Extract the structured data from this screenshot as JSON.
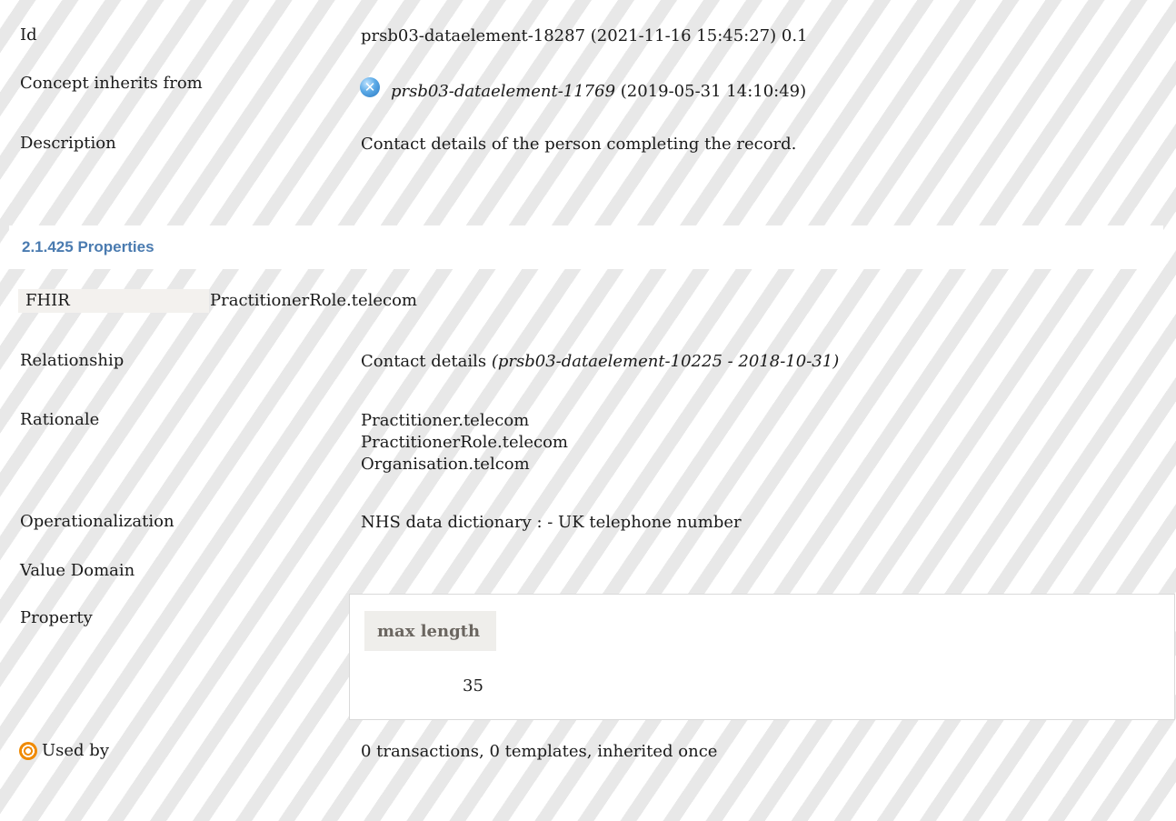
{
  "concept": {
    "id_label": "Id",
    "id_value": "prsb03-dataelement-18287 (2021-11-16 15:45:27) 0.1",
    "inherits_label": "Concept inherits from",
    "inherits_ref": "prsb03-dataelement-11769",
    "inherits_date": " (2019-05-31 14:10:49)",
    "inherits_icon": "remove-circle-icon",
    "description_label": "Description",
    "description_value": "Contact details of the person completing the record."
  },
  "properties": {
    "section_title": "2.1.425 Properties",
    "fhir_label": "FHIR",
    "fhir_value": "PractitionerRole.telecom",
    "relationship_label": "Relationship",
    "relationship_name": "Contact details ",
    "relationship_ref": "(prsb03-dataelement-10225 - 2018-10-31)",
    "rationale_label": "Rationale",
    "rationale_lines": [
      "Practitioner.telecom",
      "PractitionerRole.telecom",
      "Organisation.telcom"
    ],
    "operationalization_label": "Operationalization",
    "operationalization_value": "NHS data dictionary : - UK telephone number",
    "value_domain_label": "Value Domain",
    "property_label": "Property",
    "property_header": "max length",
    "property_value": "35",
    "used_by_icon": "target-icon",
    "used_by_label": "Used by",
    "used_by_value": "0 transactions, 0 templates, inherited once"
  },
  "colors": {
    "section_title": "#4a7bb0",
    "stripe": "#e8e8e8",
    "inherits_icon": "#3a8ad6",
    "used_by_icon": "#f08a00"
  }
}
